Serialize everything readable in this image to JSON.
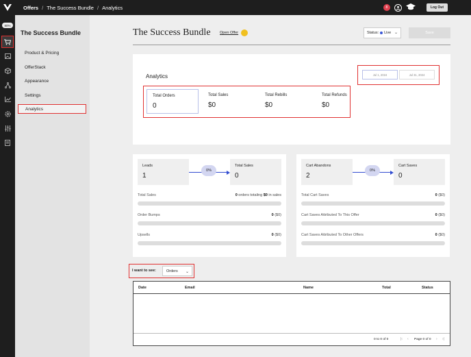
{
  "header": {
    "breadcrumb": [
      "Offers",
      "The Success Bundle",
      "Analytics"
    ],
    "notification_count": "8",
    "logout_label": "Log Out"
  },
  "rail": {
    "progress": "80%",
    "icons": [
      "cart-icon",
      "image-icon",
      "box-icon",
      "network-icon",
      "chart-icon",
      "gear-icon",
      "sliders-icon",
      "book-icon"
    ]
  },
  "sidebar": {
    "title": "The Success Bundle",
    "items": [
      {
        "label": "Product & Pricing"
      },
      {
        "label": "OfferStack"
      },
      {
        "label": "Appearance"
      },
      {
        "label": "Settings"
      },
      {
        "label": "Analytics"
      }
    ]
  },
  "page": {
    "title": "The Success Bundle",
    "open_offer": "Open Offer",
    "status_label": "Status:",
    "status_value": "Live",
    "save_label": "Save"
  },
  "analytics": {
    "title": "Analytics",
    "date_start": "Jul 1, 2024",
    "date_end": "Jul 31, 2024",
    "metrics": [
      {
        "label": "Total Orders",
        "value": "0"
      },
      {
        "label": "Total Sales",
        "value": "$0"
      },
      {
        "label": "Total Rebills",
        "value": "$0"
      },
      {
        "label": "Total Refunds",
        "value": "$0"
      }
    ]
  },
  "funnel_left": {
    "from_label": "Leads",
    "from_value": "1",
    "pct": "0%",
    "to_label": "Total Sales",
    "to_value": "0",
    "rows": [
      {
        "label": "Total Sales",
        "count": "0",
        "mid": " orders totaling ",
        "amount": "$0",
        "suffix": " in sales"
      },
      {
        "label": "Order Bumps",
        "count": "0",
        "amount": " ($0)"
      },
      {
        "label": "Upsells",
        "count": "0",
        "amount": " ($0)"
      }
    ]
  },
  "funnel_right": {
    "from_label": "Cart Abandons",
    "from_value": "2",
    "pct": "0%",
    "to_label": "Cart Saves",
    "to_value": "0",
    "rows": [
      {
        "label": "Total Cart Saves",
        "count": "0",
        "amount": " ($0)"
      },
      {
        "label": "Cart Saves Attributed To This Offer",
        "count": "0",
        "amount": " ($0)"
      },
      {
        "label": "Cart Saves Attributed To Other Offers",
        "count": "0",
        "amount": " ($0)"
      }
    ]
  },
  "filter": {
    "label": "I want to see:",
    "value": "Orders"
  },
  "table": {
    "columns": [
      "Date",
      "Email",
      "Name",
      "Total",
      "Status"
    ],
    "count_text": "0 to 0 of 0",
    "page_text": "Page 0 of 0"
  }
}
